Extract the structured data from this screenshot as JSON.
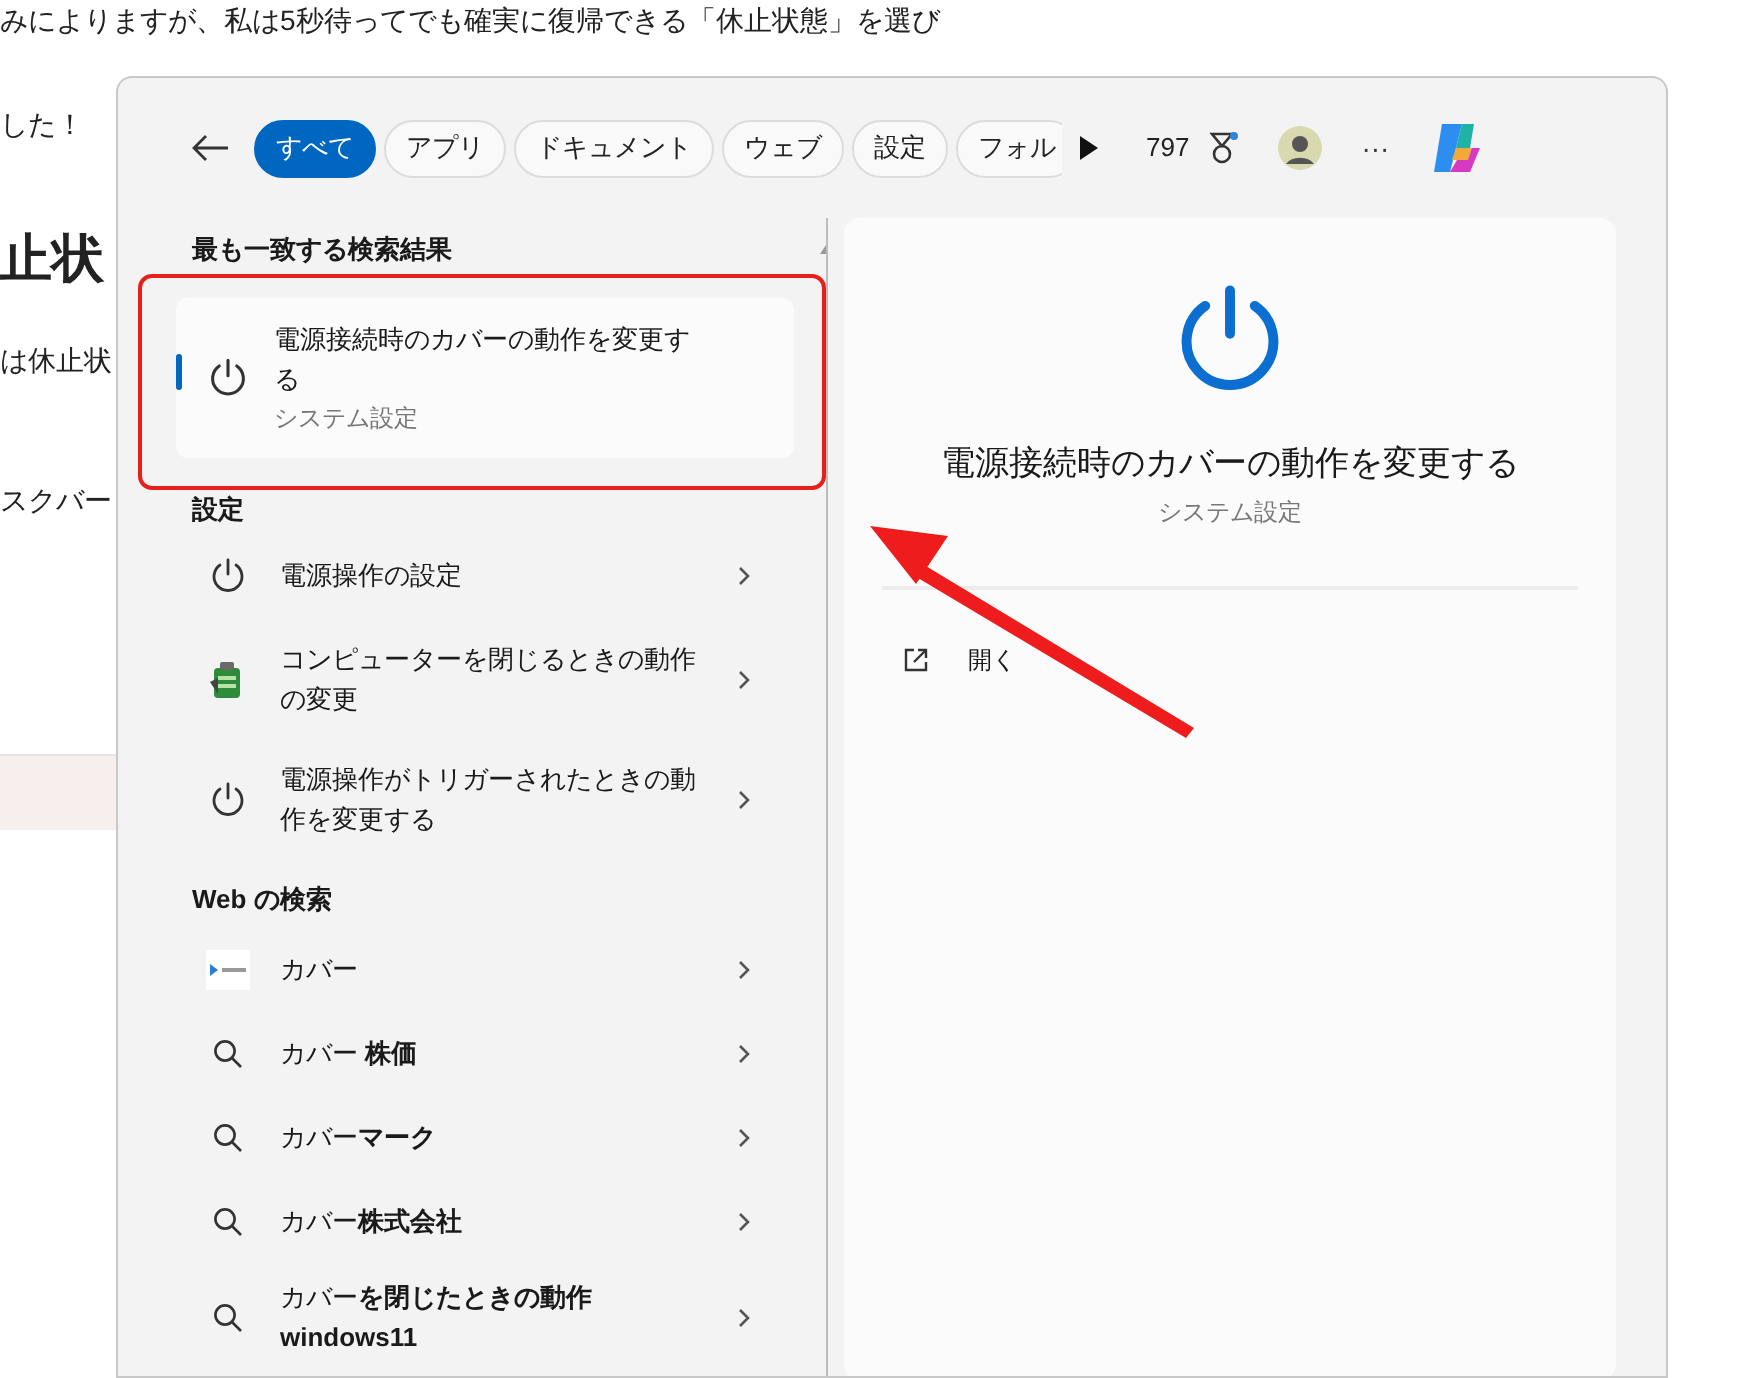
{
  "article": {
    "lines": [
      {
        "kind": "text",
        "text": "みによりますが、私は5秒待ってでも確実に復帰できる「休止状態」を選び"
      },
      {
        "kind": "text",
        "text": "した！"
      },
      {
        "kind": "heading",
        "text": "止状"
      },
      {
        "kind": "text",
        "text": "は休止状"
      },
      {
        "kind": "text",
        "text": "スクバー"
      }
    ]
  },
  "search_window": {
    "tabs": [
      {
        "label": "すべて",
        "selected": true
      },
      {
        "label": "アプリ",
        "selected": false
      },
      {
        "label": "ドキュメント",
        "selected": false
      },
      {
        "label": "ウェブ",
        "selected": false
      },
      {
        "label": "設定",
        "selected": false
      },
      {
        "label": "フォル",
        "selected": false
      }
    ],
    "points": "797",
    "more": "···",
    "best_match": {
      "heading": "最も一致する検索結果",
      "item": {
        "title": "電源接続時のカバーの動作を変更する",
        "subtitle": "システム設定",
        "selected": true
      }
    },
    "settings": {
      "heading": "設定",
      "items": [
        {
          "kind": "power",
          "title": "電源操作の設定"
        },
        {
          "kind": "battery",
          "title": "コンピューターを閉じるときの動作の変更"
        },
        {
          "kind": "power",
          "title": "電源操作がトリガーされたときの動作を変更する"
        }
      ]
    },
    "web": {
      "heading": "Web の検索",
      "items": [
        {
          "kind": "site",
          "text": "カバー"
        },
        {
          "kind": "search",
          "text": "カバー **株価**"
        },
        {
          "kind": "search",
          "text": "カバー**マーク**"
        },
        {
          "kind": "search",
          "text": "カバー**株式会社**"
        },
        {
          "kind": "search",
          "text": "カバー**を閉じたときの動作 windows11**"
        }
      ]
    },
    "preview": {
      "title": "電源接続時のカバーの動作を変更する",
      "subtitle": "システム設定",
      "actions": [
        {
          "label": "開く"
        }
      ]
    }
  }
}
